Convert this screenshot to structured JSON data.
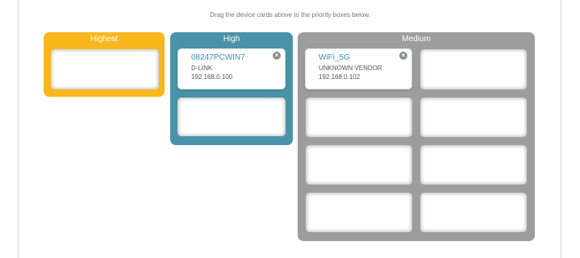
{
  "instruction": "Drag the device cards above to the priority boxes below.",
  "panels": {
    "highest": {
      "title": "Highest",
      "color": "#f7b71d"
    },
    "high": {
      "title": "High",
      "color": "#4a92a7"
    },
    "medium": {
      "title": "Medium",
      "color": "#9d9d9d"
    }
  },
  "devices": [
    {
      "name": "08247PCWIN7",
      "vendor": "D-LINK",
      "ip": "192.168.0.100",
      "priority": "High"
    },
    {
      "name": "WiFi_5G",
      "vendor": "UNKNOWN VENDOR",
      "ip": "192.168.0.102",
      "priority": "Medium"
    }
  ],
  "icons": {
    "remove": "close-icon"
  }
}
